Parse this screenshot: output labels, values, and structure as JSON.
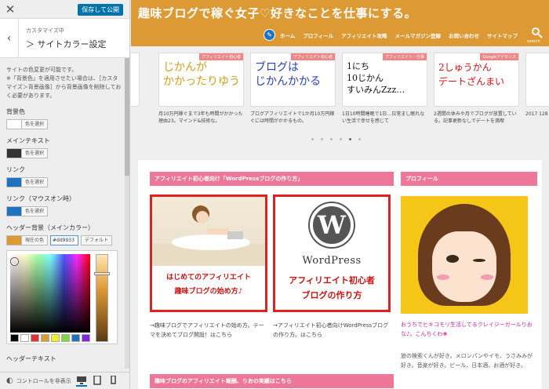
{
  "sidebar": {
    "save_label": "保存して公開",
    "breadcrumb": "カスタマイズ中 ＞ サイトカラー設定",
    "crumb_top": "カスタマイズ中",
    "title": "＞ サイトカラー設定",
    "description": "サイトの色変更が可能です。\n※「背景色」を適用させたい場合は、［カスタマイズ＞背景画像］から背景画像を削除しておく必要があります。",
    "controls": [
      {
        "label": "背景色",
        "button": "色を選択",
        "color": "#ffffff"
      },
      {
        "label": "メインテキスト",
        "button": "色を選択",
        "color": "#333333"
      },
      {
        "label": "リンク",
        "button": "色を選択",
        "color": "#1e73be"
      },
      {
        "label": "リンク（マウスオン時）",
        "button": "色を選択",
        "color": "#1e73be"
      }
    ],
    "header_bg": {
      "label": "ヘッダー背景（メインカラー）",
      "current_label": "現在の色",
      "hex_value": "#dd9933",
      "default_label": "デフォルト",
      "color": "#dd9933"
    },
    "palette": [
      "#000000",
      "#ffffff",
      "#dd3333",
      "#dd9933",
      "#eeee22",
      "#81d742",
      "#1e73be",
      "#8224e3"
    ],
    "next_label": "ヘッダーテキスト",
    "footer": {
      "collapse_label": "コントロールを非表示"
    }
  },
  "site": {
    "title": "趣味ブログで稼ぐ女子♡好きなことを仕事にする。",
    "nav": [
      "ホーム",
      "プロフィール",
      "アフィリエイト攻略",
      "メールマガジン登録",
      "お問い合わせ",
      "サイトマップ"
    ],
    "search_label": "search",
    "carousel": [
      {
        "category": "",
        "image_text": "",
        "caption": ""
      },
      {
        "category": "アフィリエイト初心者",
        "image_text": "じかんが\nかかったりゆう",
        "caption": "月10万円稼ぐまで3年も時間がかかった理由23。マインド&技術な。"
      },
      {
        "category": "アフィリエイト初心者",
        "image_text": "ブログは\nじかんかかる",
        "caption": "ブログアフィリエイトで1か月10万円稼ぐには時間がかかるもの。"
      },
      {
        "category": "アフィリエイト・仕事",
        "image_text": "1にち\n10じかん\nすいみんZzz…",
        "caption": "1日10時間睡眠で1日…日常まし眠れない生活で幸せを感じて"
      },
      {
        "category": "Googleアドセンス",
        "image_text": "2しゅうかん\nデートざんまい",
        "caption": "2週間の休みや月でブログが放置している。記事更新なしでデートを満喫"
      },
      {
        "category": "",
        "image_text": "",
        "caption": "2017\n128"
      }
    ],
    "featured_title": "アフィリエイト初心者向け「WordPressブログの作り方」",
    "featured": [
      {
        "overlay": "はじめてのアフィリエイト\n趣味ブログの始め方♪",
        "caption": "→趣味ブログでアフィリエイトの始め方。テーマを決めてブログ開設！はこちら"
      },
      {
        "overlay": "アフィリエイト初心者\nブログの作り方",
        "wordmark": "WordPress",
        "logo_letter": "W",
        "caption": "→アフィリエイト初心者向けWordPressブログの作り方。はこちら"
      }
    ],
    "profile_title": "プロフィール",
    "profile_link": "おうちでヒキコモリ生活してるクレイジーガールりおな♪。こんちくわ❀",
    "profile_text": "旅の検索くんが好き。メロンパンやイモ、うさみみが好き。音楽が好き。ビール、日本酒、お酒が好き。",
    "latest_title": "趣味ブログのアフィリエイト報酬、りおの実績はこちら"
  }
}
